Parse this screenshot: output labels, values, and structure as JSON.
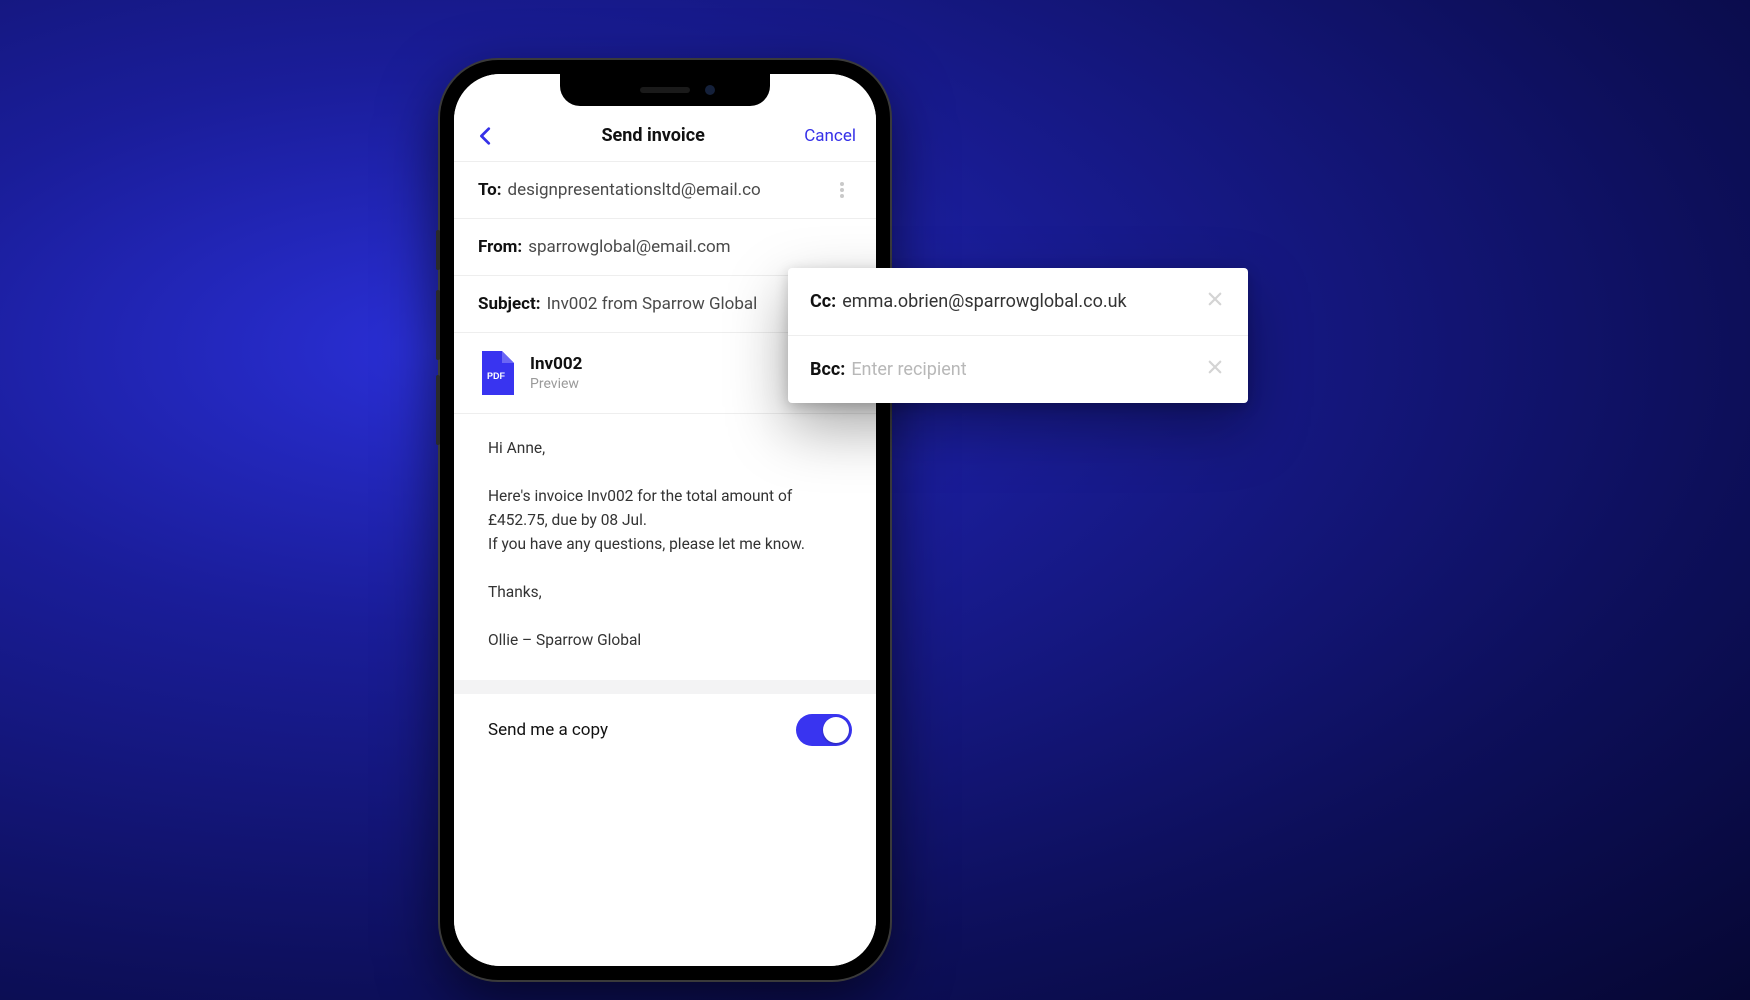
{
  "nav": {
    "title": "Send invoice",
    "cancel": "Cancel"
  },
  "fields": {
    "to_label": "To:",
    "to_value": "designpresentationsltd@email.co",
    "from_label": "From:",
    "from_value": "sparrowglobal@email.com",
    "subject_label": "Subject:",
    "subject_value": "Inv002 from Sparrow Global"
  },
  "attachment": {
    "badge": "PDF",
    "name": "Inv002",
    "action": "Preview"
  },
  "body": "Hi Anne,\n\nHere's invoice Inv002 for the total amount of £452.75, due by 08 Jul.\nIf you have any questions, please let me know.\n\nThanks,\n\nOllie – Sparrow Global",
  "copy": {
    "label": "Send me a copy",
    "on": true
  },
  "popup": {
    "cc_label": "Cc:",
    "cc_value": "emma.obrien@sparrowglobal.co.uk",
    "bcc_label": "Bcc:",
    "bcc_placeholder": "Enter recipient"
  },
  "colors": {
    "accent": "#3530e8"
  }
}
